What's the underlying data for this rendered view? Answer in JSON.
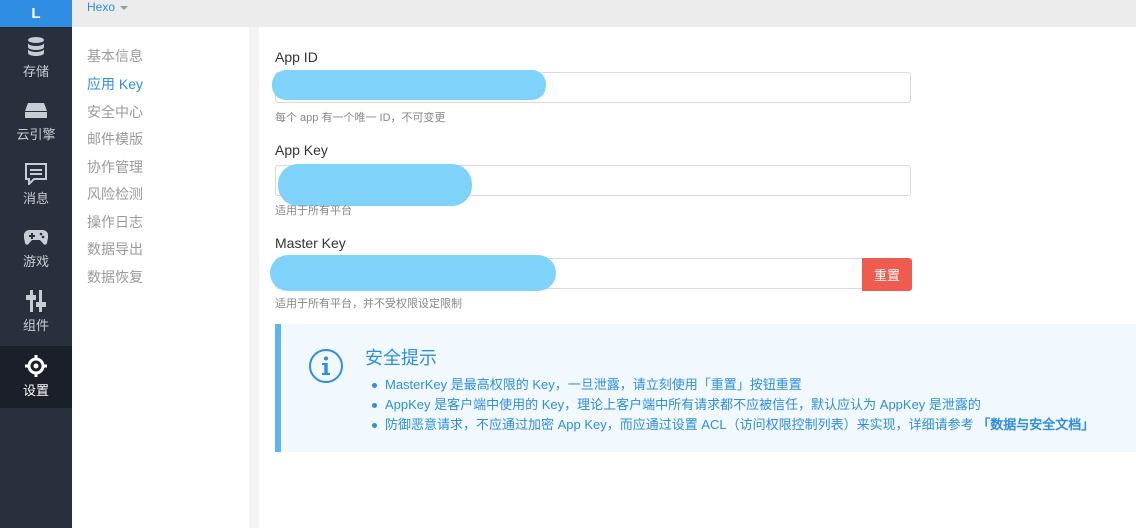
{
  "rail": {
    "logo": "L",
    "items": [
      {
        "label": "存储",
        "icon": "database-icon"
      },
      {
        "label": "云引擎",
        "icon": "server-icon"
      },
      {
        "label": "消息",
        "icon": "message-icon"
      },
      {
        "label": "游戏",
        "icon": "gamepad-icon"
      },
      {
        "label": "组件",
        "icon": "sliders-icon"
      },
      {
        "label": "设置",
        "icon": "gear-icon"
      }
    ],
    "active": "设置"
  },
  "topbar": {
    "app_name": "Hexo"
  },
  "subnav": {
    "items": [
      "基本信息",
      "应用 Key",
      "安全中心",
      "邮件模版",
      "协作管理",
      "风险检测",
      "操作日志",
      "数据导出",
      "数据恢复"
    ],
    "active": "应用 Key"
  },
  "fields": {
    "app_id": {
      "label": "App ID",
      "help": "每个 app 有一个唯一 ID，不可变更",
      "value": ""
    },
    "app_key": {
      "label": "App Key",
      "help": "适用于所有平台",
      "value": ""
    },
    "master_key": {
      "label": "Master Key",
      "help": "适用于所有平台，并不受权限设定限制",
      "value": "",
      "reset_label": "重置"
    }
  },
  "notice": {
    "title": "安全提示",
    "items": [
      "MasterKey 是最高权限的 Key，一旦泄露，请立刻使用「重置」按钮重置",
      "AppKey 是客户端中使用的 Key，理论上客户端中所有请求都不应被信任，默认应认为 AppKey 是泄露的",
      "防御恶意请求，不应通过加密 App Key，而应通过设置 ACL（访问权限控制列表）来实现，详细请参考 "
    ],
    "link_text": "「数据与安全文档」"
  },
  "colors": {
    "accent": "#2f8de4",
    "danger": "#f05b50",
    "rail": "#2a2f3d",
    "mask": "#7fd3fb"
  }
}
